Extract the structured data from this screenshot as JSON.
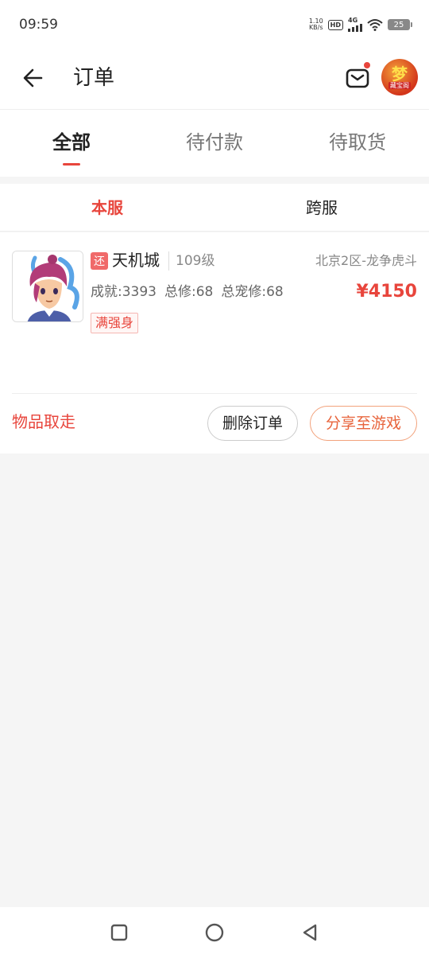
{
  "status_bar": {
    "time": "09:59",
    "net_speed_value": "1.10",
    "net_speed_unit": "KB/s",
    "hd_label": "HD",
    "signal_label": "4G",
    "battery_level": "25",
    "icons": [
      "hd-icon",
      "signal-icon",
      "wifi-icon",
      "battery-icon"
    ]
  },
  "header": {
    "title": "订单",
    "back_icon": "arrow-left-icon",
    "mail_icon": "mail-icon",
    "avatar_char": "梦",
    "avatar_sub": "藏宝阁"
  },
  "tabs": [
    {
      "label": "全部",
      "active": true
    },
    {
      "label": "待付款",
      "active": false
    },
    {
      "label": "待取货",
      "active": false
    }
  ],
  "sub_tabs": [
    {
      "label": "本服",
      "active": true
    },
    {
      "label": "跨服",
      "active": false
    }
  ],
  "order": {
    "badge": "还",
    "name": "天机城",
    "level": "109级",
    "server": "北京2区-龙争虎斗",
    "stats": [
      "成就:3393",
      "总修:68",
      "总宠修:68"
    ],
    "price": "¥4150",
    "tag": "满强身",
    "status": "物品取走",
    "delete_label": "删除订单",
    "share_label": "分享至游戏"
  },
  "colors": {
    "accent": "#e8453c",
    "share_border": "#f2a27c",
    "background": "#f5f5f5"
  },
  "nav_bar": {
    "icons": [
      "recents-square-icon",
      "home-circle-icon",
      "back-triangle-icon"
    ]
  }
}
